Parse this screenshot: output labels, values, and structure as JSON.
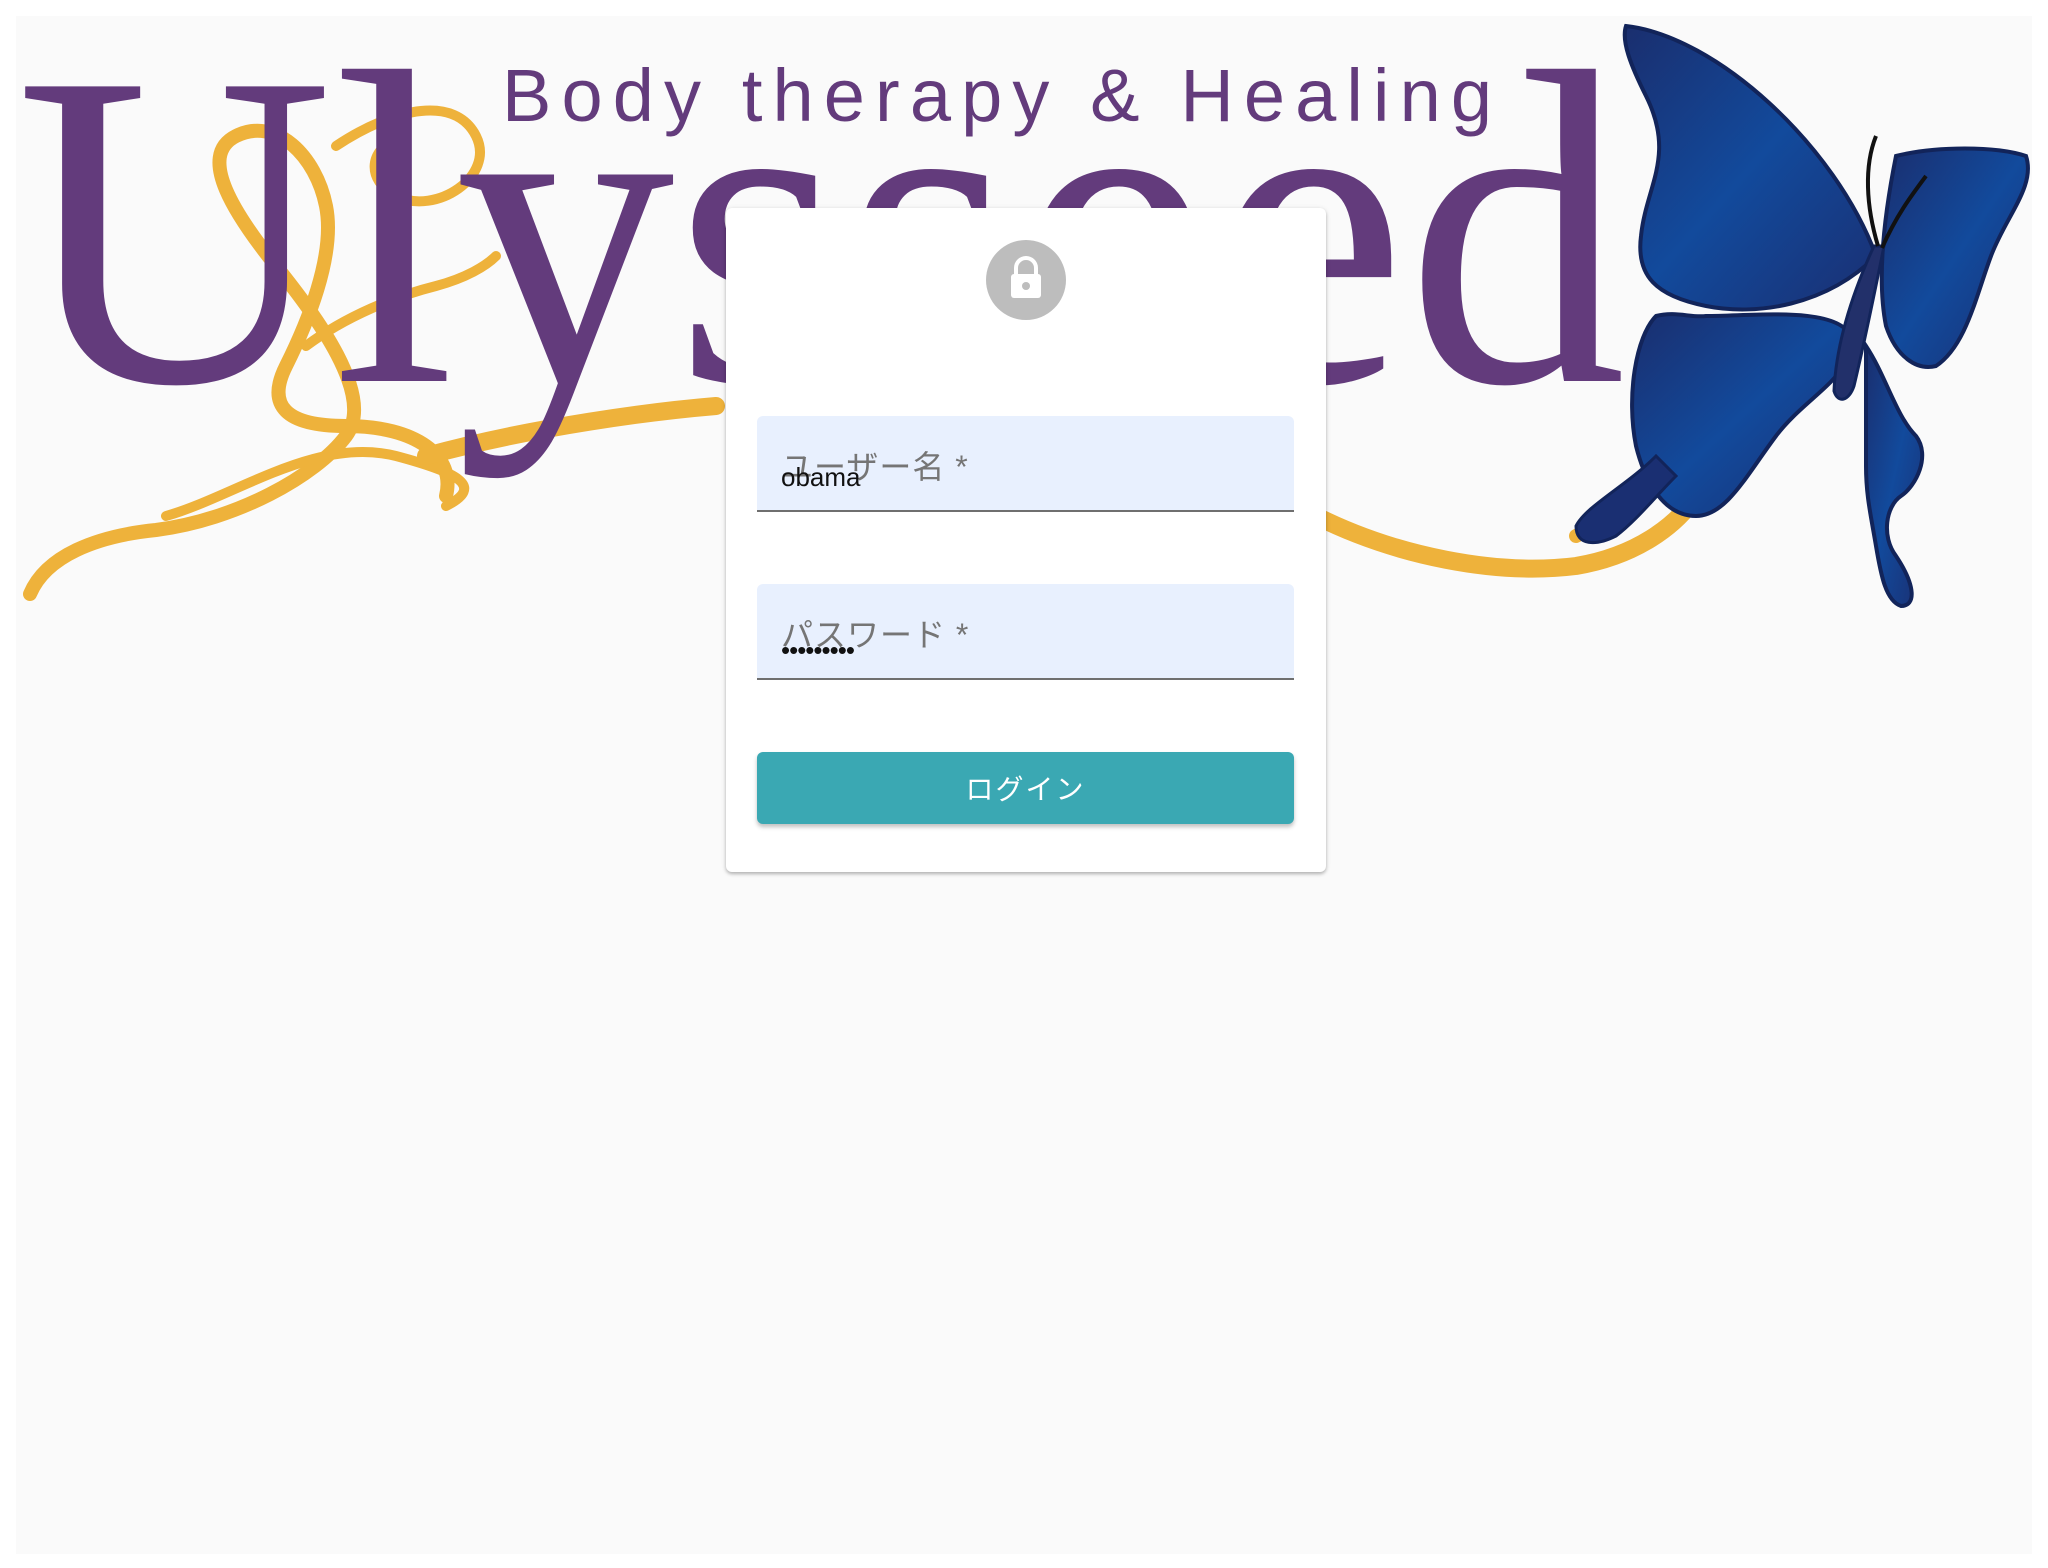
{
  "logo": {
    "wordmark": "Ulysseed",
    "tagline": "Body therapy & Healing",
    "icons": [
      "golden-swirl-icon",
      "butterfly-icon"
    ]
  },
  "login": {
    "avatar_icon": "lock-icon",
    "username": {
      "label": "ユーザー名 *",
      "value": "obama"
    },
    "password": {
      "label": "パスワード *",
      "value": "•••••••••"
    },
    "submit_label": "ログイン"
  },
  "colors": {
    "page_background": "#fafafa",
    "card_background": "#ffffff",
    "field_background": "#e8f0fe",
    "button": "#3aa8b3",
    "logo_purple": "#633b7c",
    "logo_gold": "#eeb23b",
    "butterfly_blue": "#1a3f8a",
    "avatar_gray": "#bdbdbd"
  }
}
